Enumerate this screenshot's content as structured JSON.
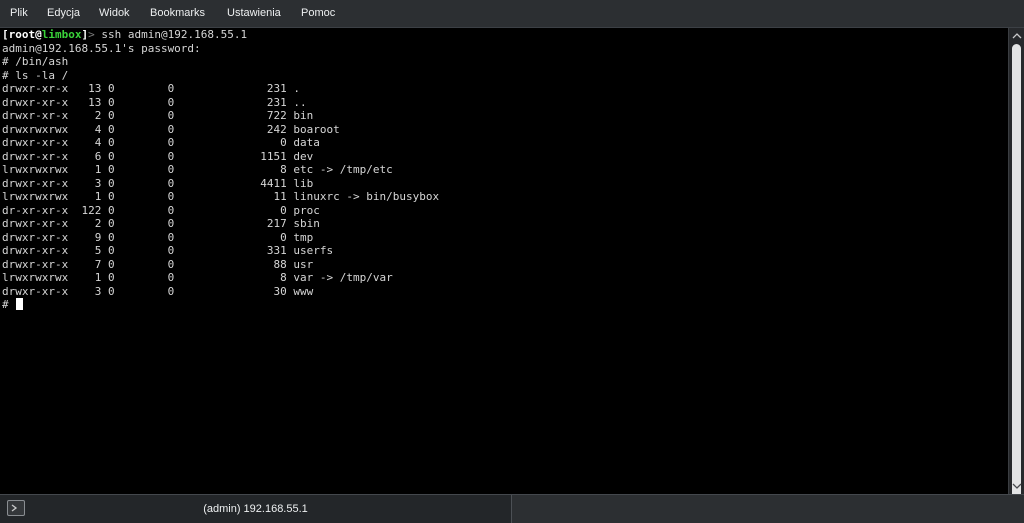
{
  "menubar": {
    "items": [
      "Plik",
      "Edycja",
      "Widok",
      "Bookmarks",
      "Ustawienia",
      "Pomoc"
    ]
  },
  "terminal": {
    "prompt": {
      "open_bracket": "[",
      "user": "root",
      "at": "@",
      "host": "limbox",
      "close_bracket": "]",
      "symbol": "> ",
      "command": "ssh admin@192.168.55.1"
    },
    "lines": [
      "admin@192.168.55.1's password:",
      "# /bin/ash",
      "# ls -la /",
      "drwxr-xr-x   13 0        0              231 .",
      "drwxr-xr-x   13 0        0              231 ..",
      "drwxr-xr-x    2 0        0              722 bin",
      "drwxrwxrwx    4 0        0              242 boaroot",
      "drwxr-xr-x    4 0        0                0 data",
      "drwxr-xr-x    6 0        0             1151 dev",
      "lrwxrwxrwx    1 0        0                8 etc -> /tmp/etc",
      "drwxr-xr-x    3 0        0             4411 lib",
      "lrwxrwxrwx    1 0        0               11 linuxrc -> bin/busybox",
      "dr-xr-xr-x  122 0        0                0 proc",
      "drwxr-xr-x    2 0        0              217 sbin",
      "drwxr-xr-x    9 0        0                0 tmp",
      "drwxr-xr-x    5 0        0              331 userfs",
      "drwxr-xr-x    7 0        0               88 usr",
      "lrwxrwxrwx    1 0        0                8 var -> /tmp/var",
      "drwxr-xr-x    3 0        0               30 www"
    ],
    "last_prompt": "# "
  },
  "tabbar": {
    "tab_label": "(admin) 192.168.55.1",
    "tab_icon": "terminal-icon"
  }
}
